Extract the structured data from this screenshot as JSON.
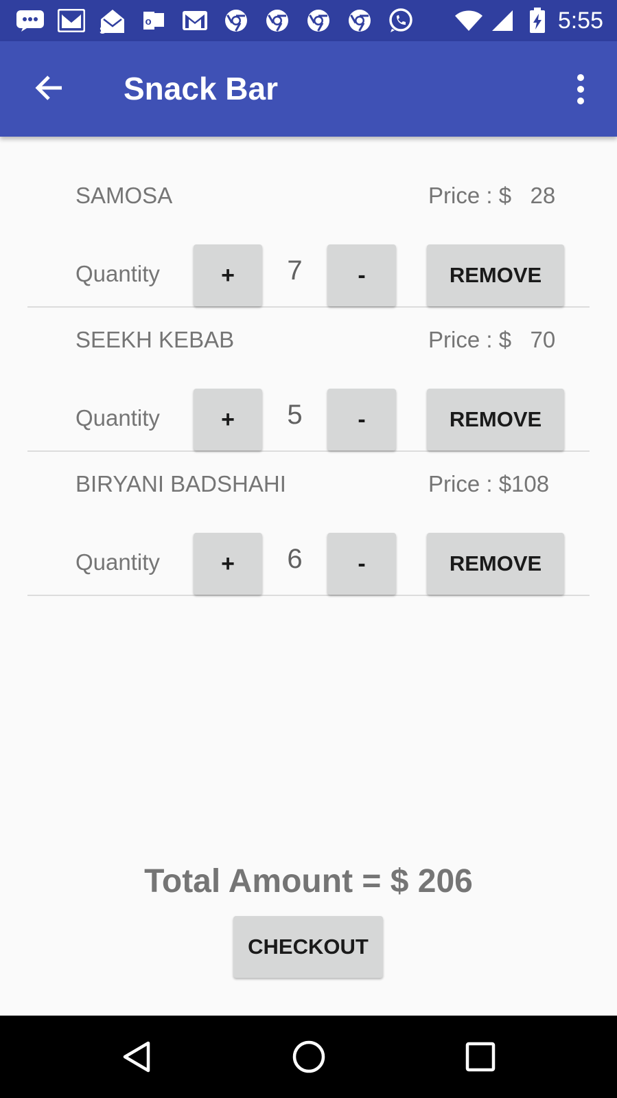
{
  "status_bar": {
    "time": "5:55",
    "icons": [
      "message-icon",
      "gmail-icon",
      "email-icon",
      "outlook-icon",
      "gmail-icon",
      "chrome-icon",
      "chrome-icon",
      "chrome-icon",
      "chrome-icon",
      "whatsapp-icon"
    ]
  },
  "app_bar": {
    "title": "Snack Bar"
  },
  "cart": {
    "quantity_label": "Quantity",
    "plus_label": "+",
    "minus_label": "-",
    "remove_label": "REMOVE",
    "items": [
      {
        "name": "SAMOSA",
        "price": "Price : $   28",
        "quantity": "7"
      },
      {
        "name": "SEEKH KEBAB",
        "price": "Price : $   70",
        "quantity": "5"
      },
      {
        "name": "BIRYANI BADSHAHI",
        "price": "Price : $108",
        "quantity": "6"
      }
    ]
  },
  "total": {
    "text": "Total Amount = $ 206"
  },
  "checkout": {
    "label": "CHECKOUT"
  },
  "colors": {
    "status_bar": "#303f9f",
    "app_bar": "#3f51b5",
    "button": "#d6d7d7",
    "text_gray": "#757575"
  }
}
